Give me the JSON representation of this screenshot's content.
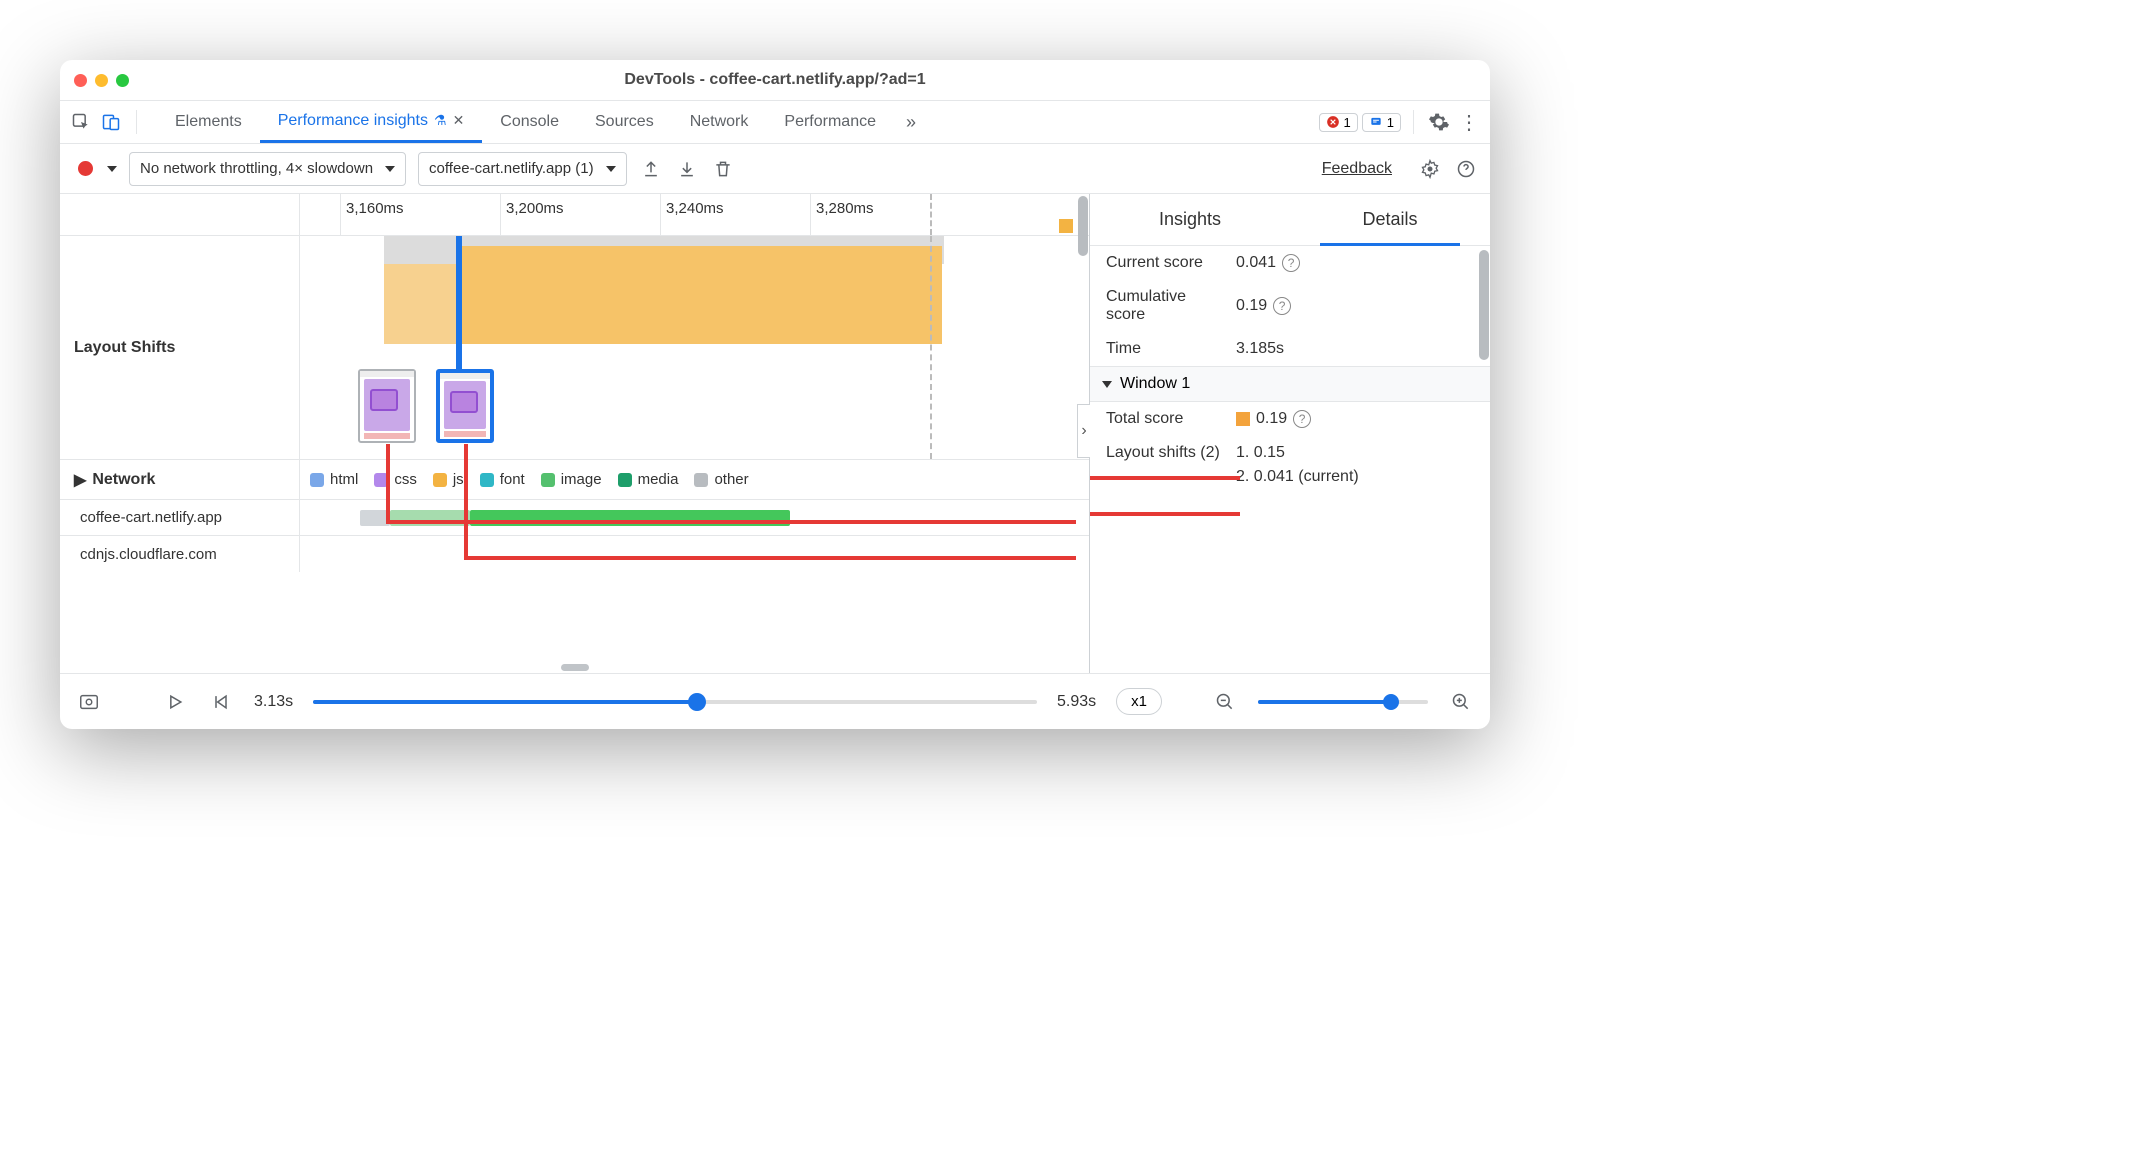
{
  "window_title": "DevTools - coffee-cart.netlify.app/?ad=1",
  "toolbar": {
    "tabs": [
      "Elements",
      "Performance insights",
      "Console",
      "Sources",
      "Network",
      "Performance"
    ],
    "active_tab": "Performance insights",
    "error_count": "1",
    "info_count": "1"
  },
  "subbar": {
    "throttling": "No network throttling, 4× slowdown",
    "recording": "coffee-cart.netlify.app (1)",
    "feedback": "Feedback"
  },
  "ruler": {
    "ticks": [
      "3,160ms",
      "3,200ms",
      "3,240ms",
      "3,280ms"
    ]
  },
  "rows": {
    "layout_shifts": "Layout Shifts",
    "network": "Network",
    "hosts": [
      "coffee-cart.netlify.app",
      "cdnjs.cloudflare.com"
    ]
  },
  "legend": {
    "html": "html",
    "css": "css",
    "js": "js",
    "font": "font",
    "image": "image",
    "media": "media",
    "other": "other"
  },
  "legend_colors": {
    "html": "#7aa7e8",
    "css": "#b388eb",
    "js": "#f3b342",
    "font": "#2fb7c6",
    "image": "#54c06e",
    "media": "#1e9e6a",
    "other": "#b8bcc0"
  },
  "details": {
    "tabs": [
      "Insights",
      "Details"
    ],
    "active": "Details",
    "current_score_label": "Current score",
    "current_score": "0.041",
    "cumulative_score_label": "Cumulative score",
    "cumulative_score": "0.19",
    "time_label": "Time",
    "time_value": "3.185s",
    "window_label": "Window 1",
    "total_score_label": "Total score",
    "total_score": "0.19",
    "layout_shifts_label": "Layout shifts (2)",
    "shift_list": [
      "1. 0.15",
      "2. 0.041 (current)"
    ]
  },
  "playbar": {
    "start": "3.13s",
    "end": "5.93s",
    "speed": "x1",
    "slider_pct": 53,
    "zoom_pct": 78
  }
}
